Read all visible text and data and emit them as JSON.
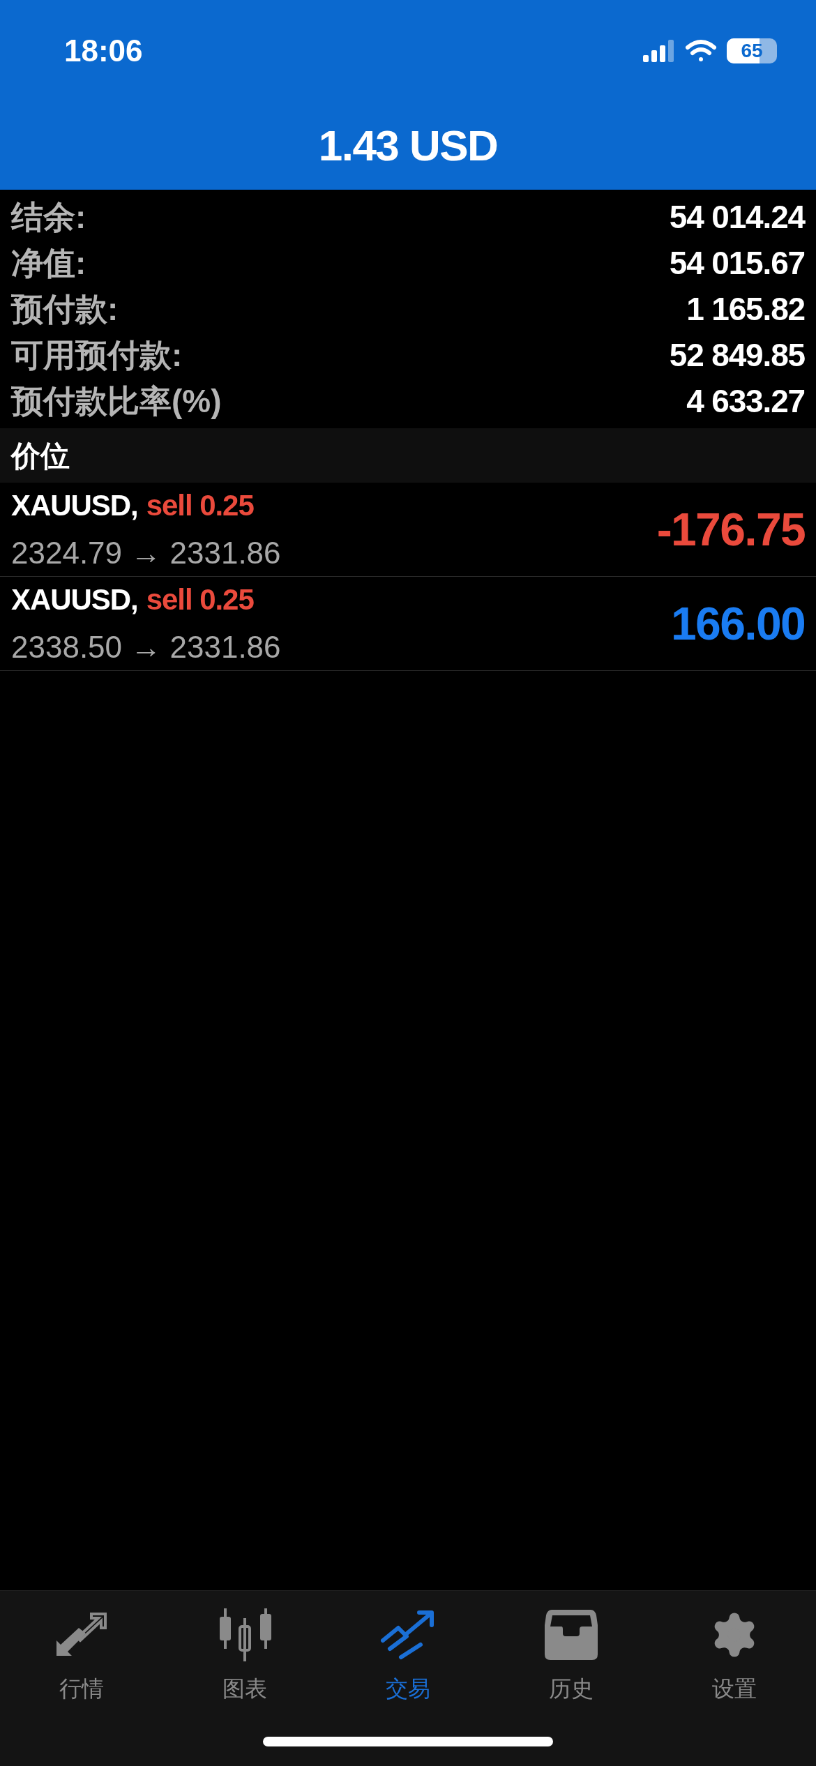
{
  "status_bar": {
    "time": "18:06",
    "battery": "65"
  },
  "header": {
    "title": "1.43 USD"
  },
  "summary": [
    {
      "label": "结余:",
      "value": "54 014.24"
    },
    {
      "label": "净值:",
      "value": "54 015.67"
    },
    {
      "label": "预付款:",
      "value": "1 165.82"
    },
    {
      "label": "可用预付款:",
      "value": "52 849.85"
    },
    {
      "label": "预付款比率(%)",
      "value": "4 633.27"
    }
  ],
  "section": {
    "title": "价位"
  },
  "positions": [
    {
      "symbol": "XAUUSD,",
      "order": "sell 0.25",
      "prices": "2324.79 → 2331.86",
      "profit": "-176.75",
      "color": "#ea4a3c"
    },
    {
      "symbol": "XAUUSD,",
      "order": "sell 0.25",
      "prices": "2338.50 → 2331.86",
      "profit": "166.00",
      "color": "#1a7cf2"
    }
  ],
  "tab_bar": [
    {
      "label": "行情",
      "selected": false
    },
    {
      "label": "图表",
      "selected": false
    },
    {
      "label": "交易",
      "selected": true
    },
    {
      "label": "历史",
      "selected": false
    },
    {
      "label": "设置",
      "selected": false
    }
  ]
}
